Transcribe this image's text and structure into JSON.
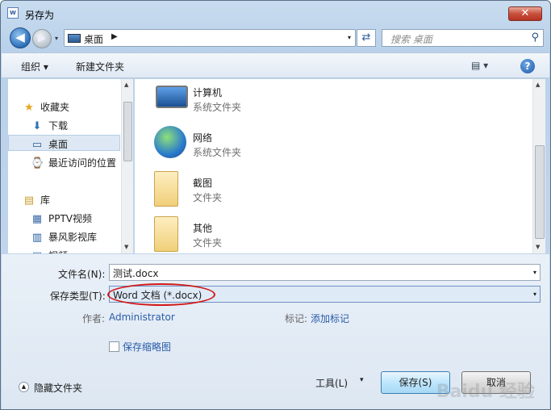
{
  "window": {
    "title": "另存为",
    "close_glyph": "✕",
    "app_icon_text": "W"
  },
  "nav": {
    "back_glyph": "◀",
    "forward_glyph": "▶",
    "dropdown_glyph": "▾"
  },
  "address": {
    "location": "桌面",
    "separator": "▶",
    "dropdown_glyph": "▾",
    "refresh_glyph": "⇄"
  },
  "search": {
    "placeholder": "搜索 桌面",
    "icon_glyph": "⚲"
  },
  "toolbar": {
    "organize": "组织 ▾",
    "new_folder": "新建文件夹",
    "view_glyph": "▤ ▾",
    "help_glyph": "?"
  },
  "sidebar": {
    "items": [
      {
        "label": "收藏夹",
        "icon": "star-icon",
        "glyph": "★"
      },
      {
        "label": "下载",
        "icon": "download-icon",
        "glyph": "⬇"
      },
      {
        "label": "桌面",
        "icon": "desktop-icon",
        "glyph": "▭"
      },
      {
        "label": "最近访问的位置",
        "icon": "recent-places-icon",
        "glyph": "⌚"
      },
      {
        "label": "库",
        "icon": "library-icon",
        "glyph": "▤"
      },
      {
        "label": "PPTV视频",
        "icon": "video-library-icon",
        "glyph": "▦"
      },
      {
        "label": "暴风影视库",
        "icon": "media-library-icon",
        "glyph": "▥"
      },
      {
        "label": "视频",
        "icon": "video-icon",
        "glyph": "▣"
      }
    ]
  },
  "content": {
    "items": [
      {
        "name": "计算机",
        "type": "系统文件夹",
        "icon": "computer-icon"
      },
      {
        "name": "网络",
        "type": "系统文件夹",
        "icon": "network-icon"
      },
      {
        "name": "截图",
        "type": "文件夹",
        "icon": "folder-icon"
      },
      {
        "name": "其他",
        "type": "文件夹",
        "icon": "folder-icon"
      }
    ]
  },
  "form": {
    "filename_label": "文件名(N):",
    "filename_value": "测试.docx",
    "filetype_label": "保存类型(T):",
    "filetype_value": "Word 文档 (*.docx)",
    "author_label": "作者:",
    "author_value": "Administrator",
    "tags_label": "标记:",
    "tags_value": "添加标记",
    "thumbnail_label": "保存缩略图",
    "dropdown_glyph": "▾"
  },
  "footer": {
    "hide_folders": "隐藏文件夹",
    "hide_glyph": "▲",
    "tools": "工具(L)",
    "tools_dropdown": "▾",
    "save": "保存(S)",
    "cancel": "取消"
  },
  "watermark": "Baidu 经验"
}
